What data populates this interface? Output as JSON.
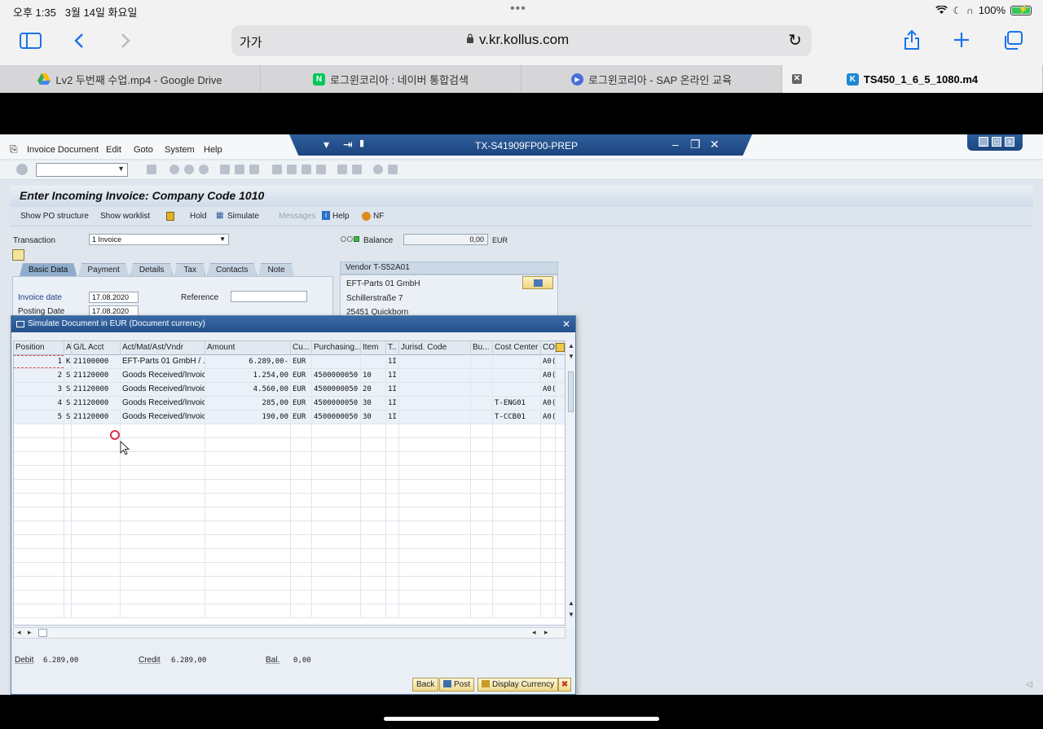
{
  "status": {
    "time": "오후 1:35",
    "date": "3월 14일 화요일",
    "battery": "100%"
  },
  "safari": {
    "reader_label": "가가",
    "url": "v.kr.kollus.com",
    "tabs": [
      {
        "label": "Lv2 두번째 수업.mp4 - Google Drive",
        "icon": "google-drive-icon"
      },
      {
        "label": "로그윈코리아 : 네이버 통합검색",
        "icon": "naver-icon",
        "fav_text": "N"
      },
      {
        "label": "로그윈코리아 - SAP 온라인 교육",
        "icon": "play-icon"
      },
      {
        "label": "TS450_1_6_5_1080.m4",
        "icon": "kollus-icon",
        "fav_text": "K"
      }
    ]
  },
  "sap": {
    "menu": [
      "Invoice Document",
      "Edit",
      "Goto",
      "System",
      "Help"
    ],
    "window_title": "TX-S41909FP00-PREP",
    "screen_title": "Enter Incoming Invoice: Company Code 1010",
    "app_toolbar": {
      "show_po": "Show PO structure",
      "show_worklist": "Show worklist",
      "hold": "Hold",
      "simulate": "Simulate",
      "messages": "Messages",
      "help": "Help",
      "nf": "NF"
    },
    "transaction_label": "Transaction",
    "transaction_value": "1 Invoice",
    "balance_label": "Balance",
    "balance_value": "0,00",
    "balance_currency": "EUR",
    "tabs": [
      "Basic Data",
      "Payment",
      "Details",
      "Tax",
      "Contacts",
      "Note"
    ],
    "invoice_date_label": "Invoice date",
    "invoice_date": "17.08.2020",
    "reference_label": "Reference",
    "posting_date_label": "Posting Date",
    "posting_date": "17.08.2020",
    "vendor": {
      "header": "Vendor T-S52A01",
      "name": "EFT-Parts 01 GmbH",
      "street": "Schillerstraße 7",
      "city": "25451 Quickborn"
    }
  },
  "popup": {
    "title": "Simulate Document in EUR (Document currency)",
    "columns": [
      "Position",
      "A",
      "G/L Acct",
      "Act/Mat/Ast/Vndr",
      "Amount",
      "Cu...",
      "Purchasing...",
      "Item",
      "T..",
      "Jurisd. Code",
      "Bu...",
      "Cost Center",
      "CO"
    ],
    "rows": [
      [
        "1",
        "K",
        "21100000",
        "EFT-Parts 01 GmbH / ..",
        "6.289,00-",
        "EUR",
        "",
        "",
        "1I",
        "",
        "",
        "",
        "A0("
      ],
      [
        "2",
        "S",
        "21120000",
        "Goods Received/Invoic..",
        "1.254,00",
        "EUR",
        "4500000050",
        "10",
        "1I",
        "",
        "",
        "",
        "A0("
      ],
      [
        "3",
        "S",
        "21120000",
        "Goods Received/Invoic..",
        "4.560,00",
        "EUR",
        "4500000050",
        "20",
        "1I",
        "",
        "",
        "",
        "A0("
      ],
      [
        "4",
        "S",
        "21120000",
        "Goods Received/Invoic..",
        "285,00",
        "EUR",
        "4500000050",
        "30",
        "1I",
        "",
        "",
        "T-ENG01",
        "A0("
      ],
      [
        "5",
        "S",
        "21120000",
        "Goods Received/Invoic..",
        "190,00",
        "EUR",
        "4500000050",
        "30",
        "1I",
        "",
        "",
        "T-CCB01",
        "A0("
      ]
    ],
    "debit_label": "Debit",
    "debit": "6.289,00",
    "credit_label": "Credit",
    "credit": "6.289,00",
    "bal_label": "Bal.",
    "bal": "0,00",
    "buttons": {
      "back": "Back",
      "post": "Post",
      "display_currency": "Display Currency"
    }
  },
  "colors": {
    "sap_blue": "#1b4580",
    "popup_bg": "#e9eff5",
    "accent_red": "#c8401e"
  }
}
